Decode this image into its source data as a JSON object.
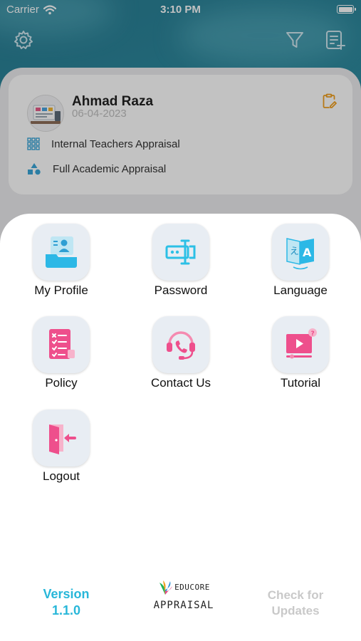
{
  "status_bar": {
    "carrier": "Carrier",
    "time": "3:10 PM"
  },
  "header": {
    "icons": [
      "gear-icon",
      "filter-icon",
      "add-list-icon"
    ]
  },
  "profile": {
    "name": "Ahmad Raza",
    "date": "06-04-2023",
    "rows": [
      {
        "icon": "grid-icon",
        "label": "Internal Teachers Appraisal"
      },
      {
        "icon": "shapes-icon",
        "label": "Full Academic Appraisal"
      }
    ]
  },
  "menu": {
    "items": [
      {
        "label": "My Profile",
        "icon": "profile-card-icon"
      },
      {
        "label": "Password",
        "icon": "password-icon"
      },
      {
        "label": "Language",
        "icon": "language-icon"
      },
      {
        "label": "Policy",
        "icon": "policy-checklist-icon"
      },
      {
        "label": "Contact Us",
        "icon": "headset-phone-icon"
      },
      {
        "label": "Tutorial",
        "icon": "video-tutorial-icon"
      },
      {
        "label": "Logout",
        "icon": "logout-door-icon"
      }
    ]
  },
  "footer": {
    "version_label": "Version",
    "version_number": "1.1.0",
    "brand_name": "EDUCORE",
    "brand_sub": "APPRAISAL",
    "check_updates_line1": "Check for",
    "check_updates_line2": "Updates"
  },
  "colors": {
    "accent": "#28b7d9",
    "pink": "#ee4f8c",
    "cyan": "#2cc0e6",
    "tile_bg": "#e8edf3",
    "disabled_text": "#c9c9c9",
    "header_bg": "#2f8ea2"
  }
}
